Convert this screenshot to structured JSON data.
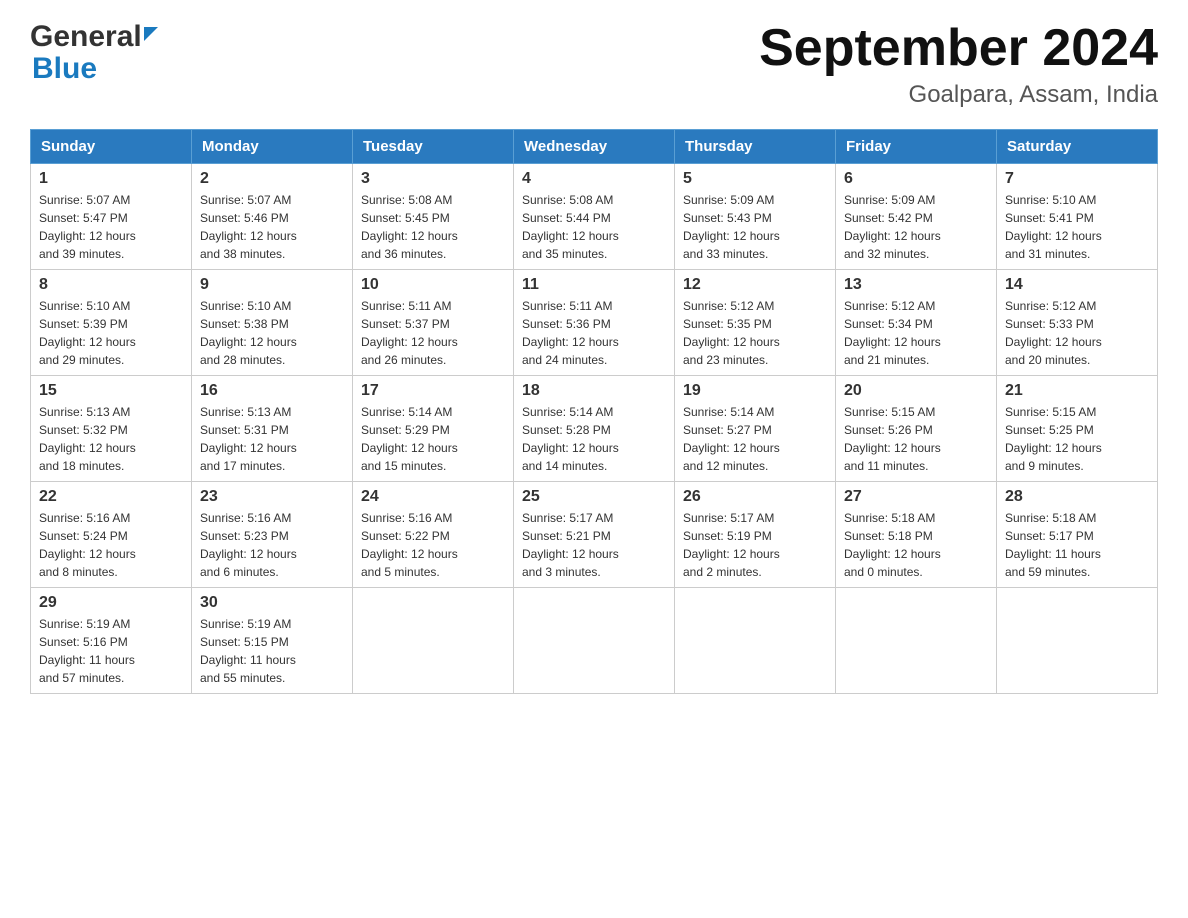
{
  "header": {
    "logo_general": "General",
    "logo_blue": "Blue",
    "title": "September 2024",
    "subtitle": "Goalpara, Assam, India"
  },
  "days_of_week": [
    "Sunday",
    "Monday",
    "Tuesday",
    "Wednesday",
    "Thursday",
    "Friday",
    "Saturday"
  ],
  "weeks": [
    [
      {
        "day": "1",
        "sunrise": "5:07 AM",
        "sunset": "5:47 PM",
        "daylight": "12 hours and 39 minutes."
      },
      {
        "day": "2",
        "sunrise": "5:07 AM",
        "sunset": "5:46 PM",
        "daylight": "12 hours and 38 minutes."
      },
      {
        "day": "3",
        "sunrise": "5:08 AM",
        "sunset": "5:45 PM",
        "daylight": "12 hours and 36 minutes."
      },
      {
        "day": "4",
        "sunrise": "5:08 AM",
        "sunset": "5:44 PM",
        "daylight": "12 hours and 35 minutes."
      },
      {
        "day": "5",
        "sunrise": "5:09 AM",
        "sunset": "5:43 PM",
        "daylight": "12 hours and 33 minutes."
      },
      {
        "day": "6",
        "sunrise": "5:09 AM",
        "sunset": "5:42 PM",
        "daylight": "12 hours and 32 minutes."
      },
      {
        "day": "7",
        "sunrise": "5:10 AM",
        "sunset": "5:41 PM",
        "daylight": "12 hours and 31 minutes."
      }
    ],
    [
      {
        "day": "8",
        "sunrise": "5:10 AM",
        "sunset": "5:39 PM",
        "daylight": "12 hours and 29 minutes."
      },
      {
        "day": "9",
        "sunrise": "5:10 AM",
        "sunset": "5:38 PM",
        "daylight": "12 hours and 28 minutes."
      },
      {
        "day": "10",
        "sunrise": "5:11 AM",
        "sunset": "5:37 PM",
        "daylight": "12 hours and 26 minutes."
      },
      {
        "day": "11",
        "sunrise": "5:11 AM",
        "sunset": "5:36 PM",
        "daylight": "12 hours and 24 minutes."
      },
      {
        "day": "12",
        "sunrise": "5:12 AM",
        "sunset": "5:35 PM",
        "daylight": "12 hours and 23 minutes."
      },
      {
        "day": "13",
        "sunrise": "5:12 AM",
        "sunset": "5:34 PM",
        "daylight": "12 hours and 21 minutes."
      },
      {
        "day": "14",
        "sunrise": "5:12 AM",
        "sunset": "5:33 PM",
        "daylight": "12 hours and 20 minutes."
      }
    ],
    [
      {
        "day": "15",
        "sunrise": "5:13 AM",
        "sunset": "5:32 PM",
        "daylight": "12 hours and 18 minutes."
      },
      {
        "day": "16",
        "sunrise": "5:13 AM",
        "sunset": "5:31 PM",
        "daylight": "12 hours and 17 minutes."
      },
      {
        "day": "17",
        "sunrise": "5:14 AM",
        "sunset": "5:29 PM",
        "daylight": "12 hours and 15 minutes."
      },
      {
        "day": "18",
        "sunrise": "5:14 AM",
        "sunset": "5:28 PM",
        "daylight": "12 hours and 14 minutes."
      },
      {
        "day": "19",
        "sunrise": "5:14 AM",
        "sunset": "5:27 PM",
        "daylight": "12 hours and 12 minutes."
      },
      {
        "day": "20",
        "sunrise": "5:15 AM",
        "sunset": "5:26 PM",
        "daylight": "12 hours and 11 minutes."
      },
      {
        "day": "21",
        "sunrise": "5:15 AM",
        "sunset": "5:25 PM",
        "daylight": "12 hours and 9 minutes."
      }
    ],
    [
      {
        "day": "22",
        "sunrise": "5:16 AM",
        "sunset": "5:24 PM",
        "daylight": "12 hours and 8 minutes."
      },
      {
        "day": "23",
        "sunrise": "5:16 AM",
        "sunset": "5:23 PM",
        "daylight": "12 hours and 6 minutes."
      },
      {
        "day": "24",
        "sunrise": "5:16 AM",
        "sunset": "5:22 PM",
        "daylight": "12 hours and 5 minutes."
      },
      {
        "day": "25",
        "sunrise": "5:17 AM",
        "sunset": "5:21 PM",
        "daylight": "12 hours and 3 minutes."
      },
      {
        "day": "26",
        "sunrise": "5:17 AM",
        "sunset": "5:19 PM",
        "daylight": "12 hours and 2 minutes."
      },
      {
        "day": "27",
        "sunrise": "5:18 AM",
        "sunset": "5:18 PM",
        "daylight": "12 hours and 0 minutes."
      },
      {
        "day": "28",
        "sunrise": "5:18 AM",
        "sunset": "5:17 PM",
        "daylight": "11 hours and 59 minutes."
      }
    ],
    [
      {
        "day": "29",
        "sunrise": "5:19 AM",
        "sunset": "5:16 PM",
        "daylight": "11 hours and 57 minutes."
      },
      {
        "day": "30",
        "sunrise": "5:19 AM",
        "sunset": "5:15 PM",
        "daylight": "11 hours and 55 minutes."
      },
      null,
      null,
      null,
      null,
      null
    ]
  ],
  "labels": {
    "sunrise": "Sunrise:",
    "sunset": "Sunset:",
    "daylight": "Daylight:"
  }
}
